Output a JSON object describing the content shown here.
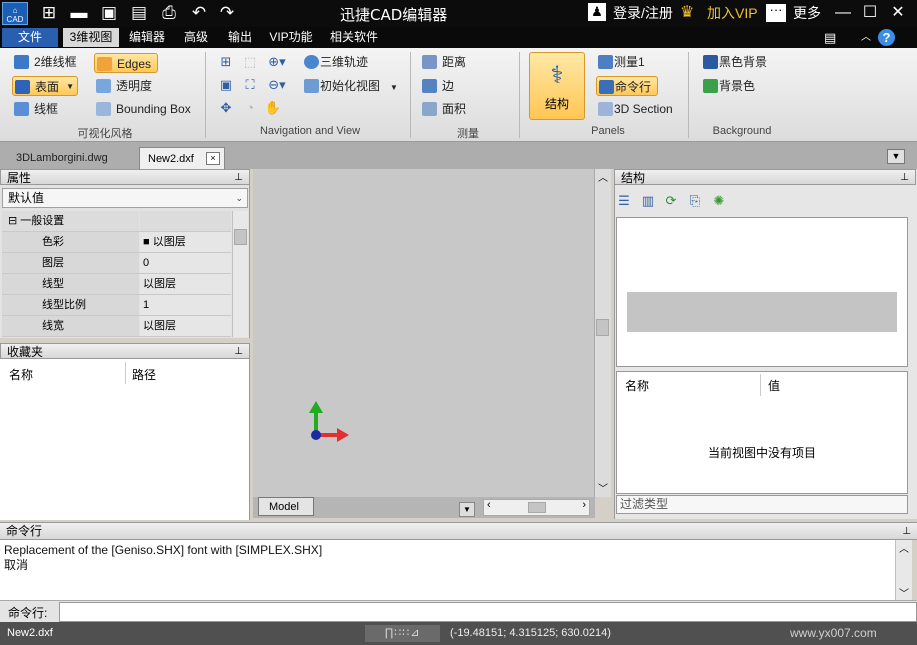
{
  "titlebar": {
    "logo_text": "CAD",
    "title": "迅捷CAD编辑器",
    "login": "登录/注册",
    "vip": "加入VIP",
    "more": "更多",
    "icons": [
      "new-icon",
      "open-folder-icon",
      "save-icon",
      "save-as-icon",
      "print-icon",
      "undo-icon",
      "redo-icon"
    ]
  },
  "menubar": {
    "file": "文件",
    "items": [
      "3维视图",
      "编辑器",
      "高级",
      "输出",
      "VIP功能",
      "相关软件"
    ]
  },
  "ribbon": {
    "visual_style": {
      "label": "可视化风格",
      "wireframe2d": "2维线框",
      "surface": "表面",
      "wireframe": "线框",
      "edges": "Edges",
      "transparency": "透明度",
      "bounding_box": "Bounding Box"
    },
    "navigation": {
      "label": "Navigation and View",
      "orbit3d": "三维轨迹",
      "initial_view": "初始化视图"
    },
    "measure": {
      "label": "测量",
      "distance": "距离",
      "edge": "边",
      "area": "面积"
    },
    "panels": {
      "label": "Panels",
      "structure": "结构",
      "measure1": "测量1",
      "command_line": "命令行",
      "section3d": "3D Section"
    },
    "background": {
      "label": "Background",
      "black_bg": "黑色背景",
      "bg_color": "背景色"
    }
  },
  "tabs": {
    "docs": [
      "3DLamborgini.dwg",
      "New2.dxf"
    ],
    "close": "×"
  },
  "properties": {
    "title": "属性",
    "combo": "默认值",
    "group": "一般设置",
    "rows": [
      {
        "key": "色彩",
        "value": "以图层",
        "swatch": "■"
      },
      {
        "key": "图层",
        "value": "0"
      },
      {
        "key": "线型",
        "value": "以图层"
      },
      {
        "key": "线型比例",
        "value": "1"
      },
      {
        "key": "线宽",
        "value": "以图层"
      }
    ]
  },
  "favorites": {
    "title": "收藏夹",
    "col_name": "名称",
    "col_path": "路径"
  },
  "viewport": {
    "model_tab": "Model"
  },
  "structure": {
    "title": "结构",
    "col_name": "名称",
    "col_value": "值",
    "empty": "当前视图中没有项目",
    "filter": "过滤类型"
  },
  "command": {
    "title": "命令行",
    "lines": [
      "Replacement of the [Geniso.SHX] font with [SIMPLEX.SHX]",
      "取消"
    ],
    "prompt": "命令行:"
  },
  "status": {
    "file": "New2.dxf",
    "tools": "∏∷∷⊿",
    "coords": "(-19.48151; 4.315125; 630.0214)",
    "watermark": "www.yx007.com"
  },
  "colors": {
    "accent": "#2a5fb0",
    "selected_fill": "#ffc85a",
    "axis_y": "#22aa22",
    "axis_x": "#e03030"
  }
}
